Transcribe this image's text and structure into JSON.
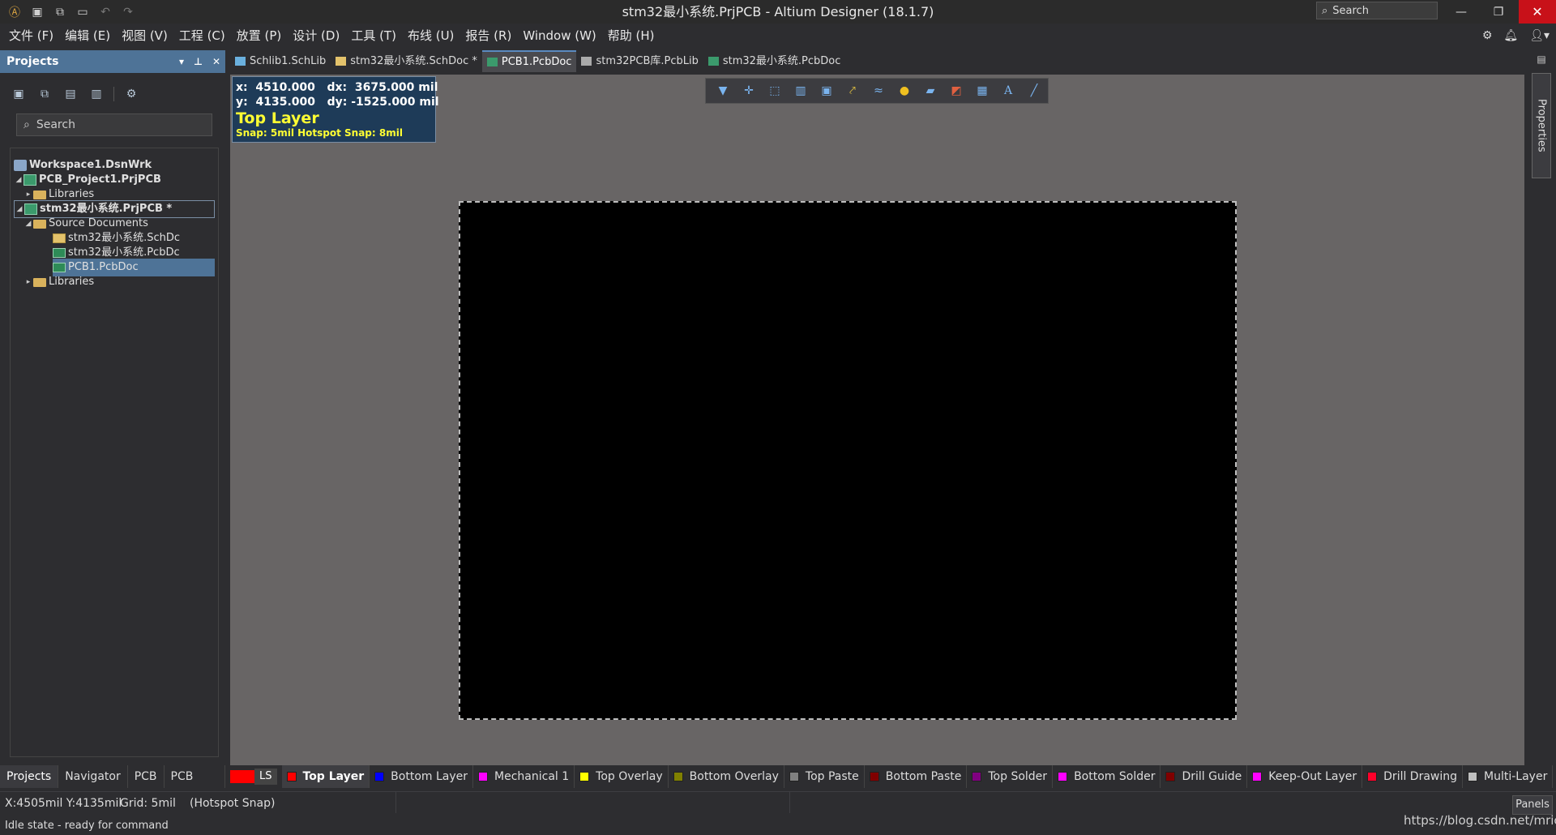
{
  "window": {
    "title": "stm32最小系统.PrjPCB - Altium Designer (18.1.7)",
    "search_placeholder": "Search",
    "min_glyph": "—",
    "restore_glyph": "❐",
    "close_glyph": "✕"
  },
  "quick_access": [
    "app-icon",
    "save-icon",
    "save-all-icon",
    "open-icon",
    "undo-icon",
    "redo-icon"
  ],
  "menu": [
    "文件 (F)",
    "编辑 (E)",
    "视图 (V)",
    "工程 (C)",
    "放置 (P)",
    "设计 (D)",
    "工具 (T)",
    "布线 (U)",
    "报告 (R)",
    "Window (W)",
    "帮助 (H)"
  ],
  "panel": {
    "title": "Projects",
    "search_placeholder": "Search",
    "tree": [
      {
        "label": "Workspace1.DsnWrk",
        "type": "workspace"
      },
      {
        "label": "PCB_Project1.PrjPCB",
        "type": "project"
      },
      {
        "label": "Libraries",
        "type": "folder"
      },
      {
        "label": "stm32最小系统.PrjPCB *",
        "type": "project"
      },
      {
        "label": "Source Documents",
        "type": "folder"
      },
      {
        "label": "stm32最小系统.SchDc",
        "type": "sch"
      },
      {
        "label": "stm32最小系统.PcbDc",
        "type": "pcb"
      },
      {
        "label": "PCB1.PcbDoc",
        "type": "pcb"
      },
      {
        "label": "Libraries",
        "type": "folder"
      }
    ],
    "bottom_tabs": [
      "Projects",
      "Navigator",
      "PCB",
      "PCB Filter"
    ]
  },
  "doc_tabs": [
    {
      "label": "Schlib1.SchLib",
      "color": "#6ab0de"
    },
    {
      "label": "stm32最小系统.SchDoc *",
      "color": "#e3c26b"
    },
    {
      "label": "PCB1.PcbDoc",
      "color": "#3b9a6c"
    },
    {
      "label": "stm32PCB库.PcbLib",
      "color": "#aaaaaa"
    },
    {
      "label": "stm32最小系统.PcbDoc",
      "color": "#3b9a6c"
    }
  ],
  "heads_up": {
    "line1": "x:  4510.000   dx:  3675.000 mil",
    "line2": "y:  4135.000   dy: -1525.000 mil",
    "layer": "Top Layer",
    "snap": "Snap: 5mil Hotspot Snap: 8mil"
  },
  "active_bar_icons": [
    "filter-icon",
    "crosshair-icon",
    "select-rect-icon",
    "align-icon",
    "component-icon",
    "route-icon",
    "diff-pair-icon",
    "via-icon",
    "polygon-icon",
    "region-icon",
    "dimension-icon",
    "string-icon",
    "line-icon"
  ],
  "properties_tab": "Properties",
  "layers": {
    "ls_label": "LS",
    "items": [
      {
        "name": "Top Layer",
        "color": "#ff0000"
      },
      {
        "name": "Bottom Layer",
        "color": "#0000ff"
      },
      {
        "name": "Mechanical 1",
        "color": "#ff00ff"
      },
      {
        "name": "Top Overlay",
        "color": "#ffff00"
      },
      {
        "name": "Bottom Overlay",
        "color": "#808000"
      },
      {
        "name": "Top Paste",
        "color": "#808080"
      },
      {
        "name": "Bottom Paste",
        "color": "#800000"
      },
      {
        "name": "Top Solder",
        "color": "#800080"
      },
      {
        "name": "Bottom Solder",
        "color": "#ff00ff"
      },
      {
        "name": "Drill Guide",
        "color": "#800000"
      },
      {
        "name": "Keep-Out Layer",
        "color": "#ff00ff"
      },
      {
        "name": "Drill Drawing",
        "color": "#ff002a"
      },
      {
        "name": "Multi-Layer",
        "color": "#c0c0c0"
      }
    ]
  },
  "status": {
    "coords": "X:4505mil Y:4135mil",
    "grid": "Grid: 5mil",
    "snap": "(Hotspot Snap)",
    "state": "Idle state - ready for command",
    "panels_button": "Panels",
    "url": "https://blog.csdn.net/mricl"
  }
}
